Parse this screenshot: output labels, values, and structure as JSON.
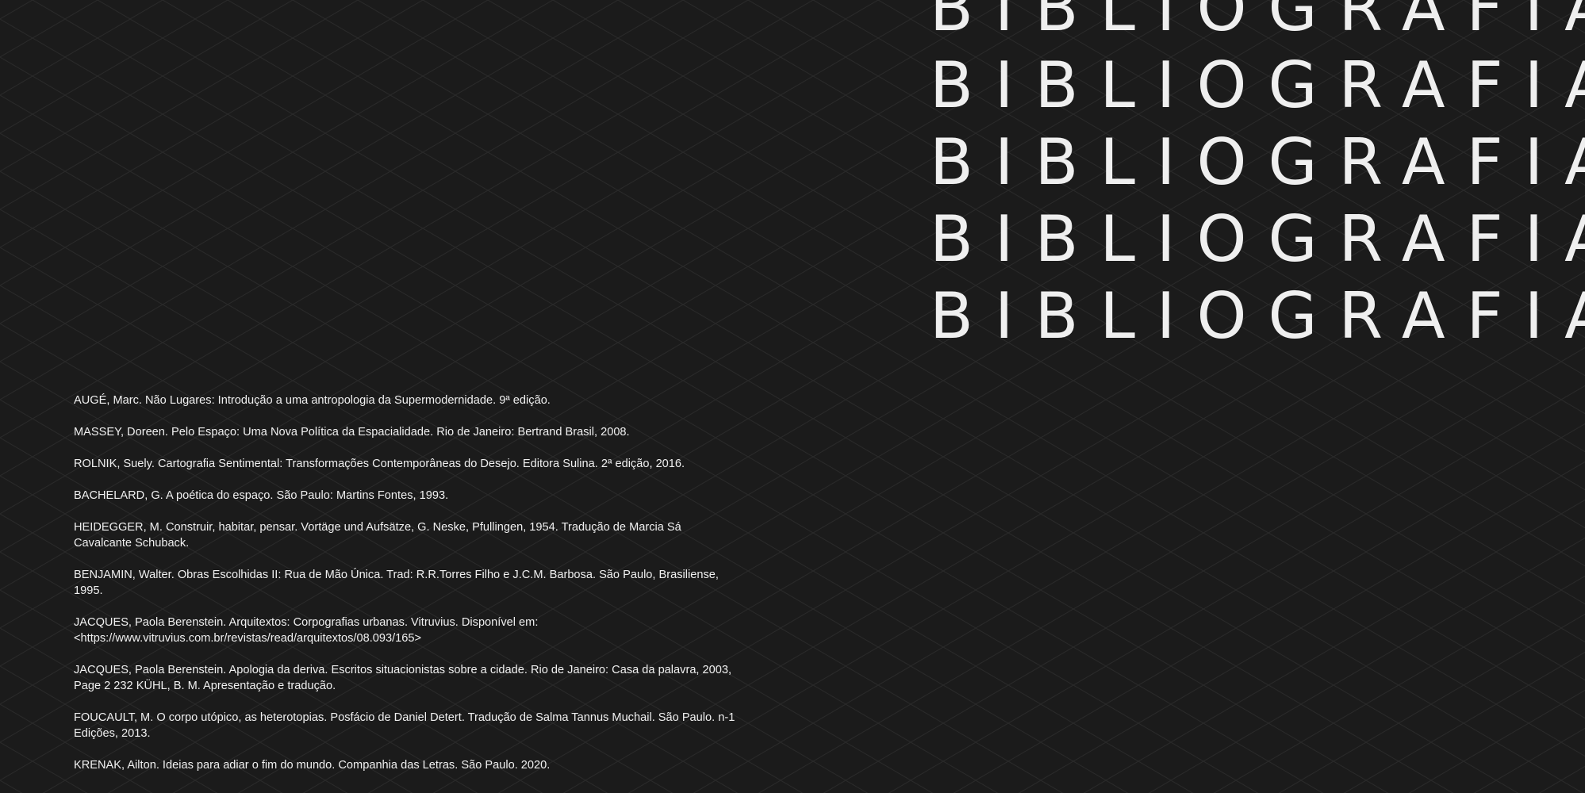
{
  "heading": {
    "lines": [
      "BIBLIOGRAFIA",
      "BIBLIOGRAFIA",
      "BIBLIOGRAFIA",
      "BIBLIOGRAFIA",
      "BIBLIOGRAFIA"
    ]
  },
  "references": [
    "AUGÉ, Marc. Não Lugares: Introdução a uma antropologia da Supermodernidade. 9ª edição.",
    "MASSEY, Doreen. Pelo Espaço: Uma Nova Política da Espacialidade. Rio de Janeiro: Bertrand Brasil, 2008.",
    "ROLNIK, Suely. Cartografia Sentimental: Transformações Contemporâneas do Desejo. Editora Sulina. 2ª edição, 2016.",
    "BACHELARD, G. A poética do espaço. São Paulo: Martins Fontes, 1993.",
    "HEIDEGGER, M. Construir, habitar, pensar. Vortäge und Aufsätze, G. Neske, Pfullingen, 1954. Tradução de Marcia Sá Cavalcante Schuback.",
    "BENJAMIN, Walter. Obras Escolhidas II: Rua de Mão Única. Trad: R.R.Torres Filho e J.C.M. Barbosa. São Paulo, Brasiliense, 1995.",
    "JACQUES, Paola Berenstein. Arquitextos: Corpografias urbanas. Vitruvius. Disponível em: <https://www.vitruvius.com.br/revistas/read/arquitextos/08.093/165>",
    "JACQUES, Paola Berenstein. Apologia da deriva. Escritos situacionistas sobre a cidade. Rio de Janeiro: Casa da palavra, 2003, Page 2 232 KÜHL, B. M. Apresentação e tradução.",
    "FOUCAULT, M. O corpo utópico, as heterotopias. Posfácio de Daniel Detert. Tradução de Salma Tannus Muchail. São Paulo. n-1 Edições, 2013.",
    "KRENAK, Ailton. Ideias para adiar o fim do mundo. Companhia das Letras. São Paulo. 2020."
  ],
  "colors": {
    "background": "#1b1b1b",
    "pattern_line": "#2a2a2a",
    "text": "#f0f0f0"
  }
}
